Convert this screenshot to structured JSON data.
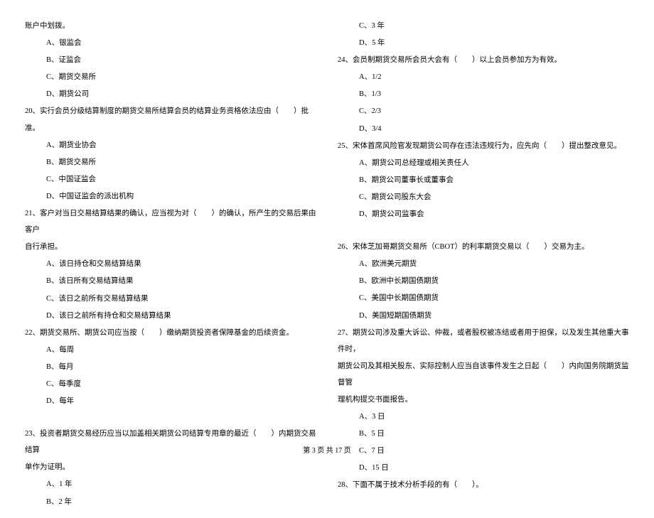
{
  "left_column": [
    {
      "text": "账户中划拨。",
      "indent": 0
    },
    {
      "text": "A、银监会",
      "indent": 1
    },
    {
      "text": "B、证监会",
      "indent": 1
    },
    {
      "text": "C、期货交易所",
      "indent": 1
    },
    {
      "text": "D、期货公司",
      "indent": 1
    },
    {
      "text": "20、实行会员分级结算制度的期货交易所结算会员的结算业务资格依法应由（　　）批准。",
      "indent": 0
    },
    {
      "text": "A、期货业协会",
      "indent": 1
    },
    {
      "text": "B、期货交易所",
      "indent": 1
    },
    {
      "text": "C、中国证监会",
      "indent": 1
    },
    {
      "text": "D、中国证监会的派出机构",
      "indent": 1
    },
    {
      "text": "21、客户对当日交易结算结果的确认，应当视为对（　　）的确认，所产生的交易后果由客户",
      "indent": 0
    },
    {
      "text": "自行承担。",
      "indent": 0
    },
    {
      "text": "A、该日持仓和交易结算结果",
      "indent": 1
    },
    {
      "text": "B、该日所有交易结算结果",
      "indent": 1
    },
    {
      "text": "C、该日之前所有交易结算结果",
      "indent": 1
    },
    {
      "text": "D、该日之前所有持仓和交易结算结果",
      "indent": 1
    },
    {
      "text": "22、期货交易所、期货公司应当按（　　）缴纳期货投资者保障基金的后续资金。",
      "indent": 0
    },
    {
      "text": "A、每周",
      "indent": 1
    },
    {
      "text": "B、每月",
      "indent": 1
    },
    {
      "text": "C、每季度",
      "indent": 1
    },
    {
      "text": "D、每年",
      "indent": 1
    },
    {
      "text": "",
      "indent": 0,
      "spacer": true
    },
    {
      "text": "23、投资者期货交易经历应当以加盖相关期货公司结算专用章的最近（　　）内期货交易结算",
      "indent": 0
    },
    {
      "text": "单作为证明。",
      "indent": 0
    },
    {
      "text": "A、1 年",
      "indent": 1
    },
    {
      "text": "B、2 年",
      "indent": 1
    }
  ],
  "right_column": [
    {
      "text": "C、3 年",
      "indent": 1
    },
    {
      "text": "D、5 年",
      "indent": 1
    },
    {
      "text": "24、会员制期货交易所会员大会有（　　）以上会员参加方为有效。",
      "indent": 0
    },
    {
      "text": "A、1/2",
      "indent": 1
    },
    {
      "text": "B、1/3",
      "indent": 1
    },
    {
      "text": "C、2/3",
      "indent": 1
    },
    {
      "text": "D、3/4",
      "indent": 1
    },
    {
      "text": "25、宋体首席风险官发现期货公司存在违法违规行为，应先向（　　）提出整改意见。",
      "indent": 0
    },
    {
      "text": "A、期货公司总经理或相关责任人",
      "indent": 1
    },
    {
      "text": "B、期货公司董事长或董事会",
      "indent": 1
    },
    {
      "text": "C、期货公司股东大会",
      "indent": 1
    },
    {
      "text": "D、期货公司监事会",
      "indent": 1
    },
    {
      "text": "",
      "indent": 0,
      "spacer": true
    },
    {
      "text": "26、宋体芝加哥期货交易所（CBOT）的利率期货交易以（　　）交易为主。",
      "indent": 0
    },
    {
      "text": "A、欧洲美元期货",
      "indent": 1
    },
    {
      "text": "B、欧洲中长期国债期货",
      "indent": 1
    },
    {
      "text": "C、美国中长期国债期货",
      "indent": 1
    },
    {
      "text": "D、美国短期国债期货",
      "indent": 1
    },
    {
      "text": "27、期货公司涉及重大诉讼、仲裁，或者股权被冻结或者用于担保，以及发生其他重大事件时，",
      "indent": 0
    },
    {
      "text": "期货公司及其相关股东、实际控制人应当自该事件发生之日起（　　）内向国务院期货监督管",
      "indent": 0
    },
    {
      "text": "理机构提交书面报告。",
      "indent": 0
    },
    {
      "text": "A、3 日",
      "indent": 1
    },
    {
      "text": "B、5 日",
      "indent": 1
    },
    {
      "text": "C、7 日",
      "indent": 1
    },
    {
      "text": "D、15 日",
      "indent": 1
    },
    {
      "text": "28、下面不属于技术分析手段的有（　　）。",
      "indent": 0
    }
  ],
  "footer": "第 3 页 共 17 页"
}
